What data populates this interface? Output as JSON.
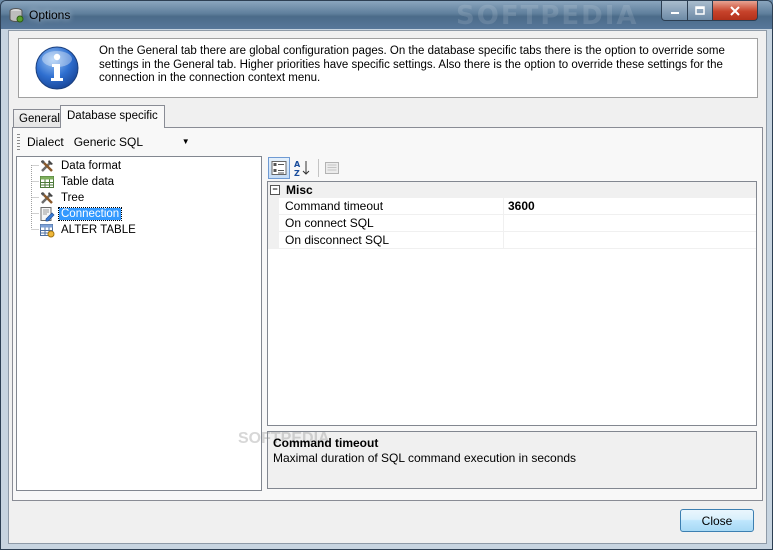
{
  "window": {
    "title": "Options",
    "watermark": "SOFTPEDIA",
    "minimize_icon": "minimize-icon",
    "maximize_icon": "maximize-icon",
    "close_icon": "close-icon"
  },
  "info": {
    "icon": "info-icon",
    "text": "On the General tab there are global configuration pages. On the database specific tabs there is the option to override some settings in the General tab. Higher priorities have specific settings. Also there is the option to override these settings for the connection in the connection context menu."
  },
  "tabs": [
    {
      "label": "General",
      "active": false
    },
    {
      "label": "Database specific",
      "active": true
    }
  ],
  "toolbar": {
    "dialect_label": "Dialect",
    "dialect_value": "Generic SQL"
  },
  "tree": {
    "items": [
      {
        "label": "Data format",
        "icon": "tools-icon",
        "selected": false
      },
      {
        "label": "Table data",
        "icon": "table-icon",
        "selected": false
      },
      {
        "label": "Tree",
        "icon": "tools-icon",
        "selected": false
      },
      {
        "label": "Connection",
        "icon": "connection-icon",
        "selected": true
      },
      {
        "label": "ALTER TABLE",
        "icon": "alter-table-icon",
        "selected": false
      }
    ]
  },
  "property_grid": {
    "toolbar": {
      "categorized_icon": "categorized-icon",
      "alphabetical_icon": "sort-az-icon",
      "property_pages_icon": "property-pages-icon"
    },
    "category": "Misc",
    "rows": [
      {
        "name": "Command timeout",
        "value": "3600",
        "bold": true
      },
      {
        "name": "On connect SQL",
        "value": ""
      },
      {
        "name": "On disconnect SQL",
        "value": ""
      }
    ],
    "help": {
      "title": "Command timeout",
      "description": "Maximal duration of SQL command execution in seconds",
      "watermark": "SOFTPEDIA"
    }
  },
  "buttons": {
    "close_label": "Close"
  }
}
